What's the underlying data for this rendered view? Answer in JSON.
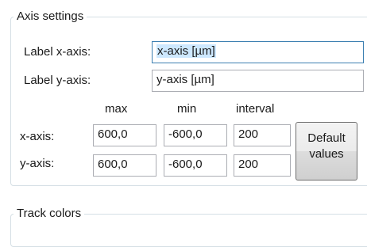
{
  "axis_settings": {
    "title": "Axis settings",
    "label_x": {
      "label": "Label x-axis:",
      "value": "x-axis [µm]"
    },
    "label_y": {
      "label": "Label y-axis:",
      "value": "y-axis [µm]"
    },
    "columns": {
      "max": "max",
      "min": "min",
      "interval": "interval"
    },
    "rows": [
      {
        "label": "x-axis:",
        "max": "600,0",
        "min": "-600,0",
        "interval": "200"
      },
      {
        "label": "y-axis:",
        "max": "600,0",
        "min": "-600,0",
        "interval": "200"
      }
    ],
    "default_button": {
      "line1": "Default",
      "line2": "values"
    }
  },
  "track_colors": {
    "title": "Track colors"
  }
}
